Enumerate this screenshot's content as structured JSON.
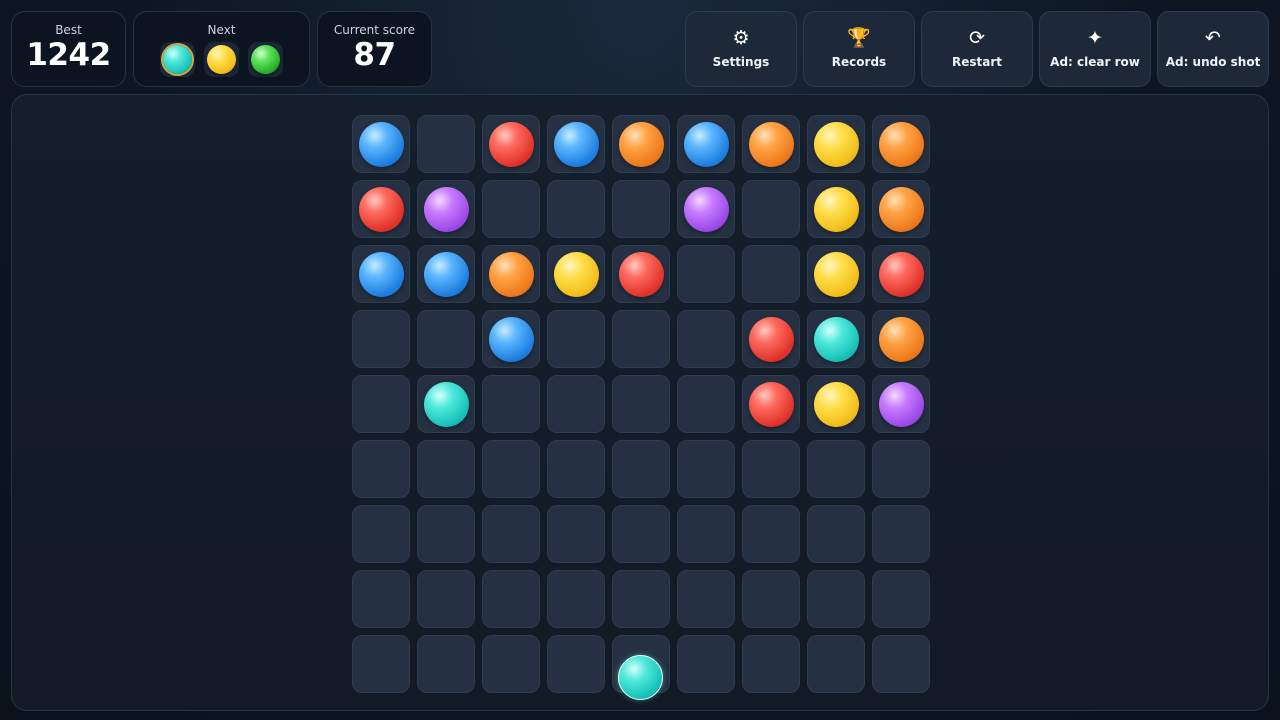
{
  "best": {
    "label": "Best",
    "value": "1242"
  },
  "next": {
    "label": "Next",
    "balls": [
      "cyan",
      "yellow",
      "green"
    ]
  },
  "score": {
    "label": "Current score",
    "value": "87"
  },
  "buttons": [
    {
      "id": "settings",
      "icon": "gear-icon",
      "glyph": "⚙",
      "label": "Settings"
    },
    {
      "id": "records",
      "icon": "trophy-icon",
      "glyph": "🏆",
      "label": "Records"
    },
    {
      "id": "restart",
      "icon": "restart-icon",
      "glyph": "⟳",
      "label": "Restart"
    },
    {
      "id": "clear-row",
      "icon": "sparkle-icon",
      "glyph": "✦",
      "label": "Ad: clear row"
    },
    {
      "id": "undo-shot",
      "icon": "undo-icon",
      "glyph": "↶",
      "label": "Ad: undo shot"
    }
  ],
  "colors": {
    "blue": "#2f8ff0",
    "red": "#e8413a",
    "orange": "#f08a2a",
    "yellow": "#f5cd2e",
    "purple": "#b062f5",
    "cyan": "#2fd3c8",
    "green": "#3fc43a",
    "accent": "#d9a53a"
  },
  "grid": {
    "rows": 9,
    "cols": 9,
    "cells": [
      [
        "blue",
        null,
        "red",
        "blue",
        "orange",
        "blue",
        "orange",
        "yellow",
        "orange"
      ],
      [
        "red",
        "purple",
        null,
        null,
        null,
        "purple",
        null,
        "yellow",
        "orange"
      ],
      [
        "blue",
        "blue",
        "orange",
        "yellow",
        "red",
        null,
        null,
        "yellow",
        "red"
      ],
      [
        null,
        null,
        "blue",
        null,
        null,
        null,
        "red",
        "cyan",
        "orange"
      ],
      [
        null,
        "cyan",
        null,
        null,
        null,
        null,
        "red",
        "yellow",
        "purple"
      ],
      [
        null,
        null,
        null,
        null,
        null,
        null,
        null,
        null,
        null
      ],
      [
        null,
        null,
        null,
        null,
        null,
        null,
        null,
        null,
        null
      ],
      [
        null,
        null,
        null,
        null,
        null,
        null,
        null,
        null,
        null
      ],
      [
        null,
        null,
        null,
        null,
        null,
        null,
        null,
        null,
        null
      ]
    ]
  },
  "shooter": {
    "color": "cyan",
    "column": 5
  }
}
